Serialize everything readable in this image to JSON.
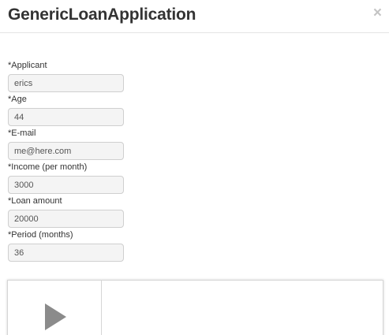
{
  "dialog": {
    "title": "GenericLoanApplication",
    "close_glyph": "×"
  },
  "form": {
    "fields": [
      {
        "label": "*Applicant",
        "value": "erics"
      },
      {
        "label": "*Age",
        "value": "44"
      },
      {
        "label": "*E-mail",
        "value": "me@here.com"
      },
      {
        "label": "*Income (per month)",
        "value": "3000"
      },
      {
        "label": "*Loan amount",
        "value": "20000"
      },
      {
        "label": "*Period (months)",
        "value": "36"
      }
    ]
  },
  "player": {
    "icon": "play-icon"
  },
  "colors": {
    "title": "#333333",
    "close": "#c4c4c4",
    "input_bg": "#f4f4f4",
    "input_border": "#cfcfcf",
    "play_icon": "#8b8b8b"
  }
}
